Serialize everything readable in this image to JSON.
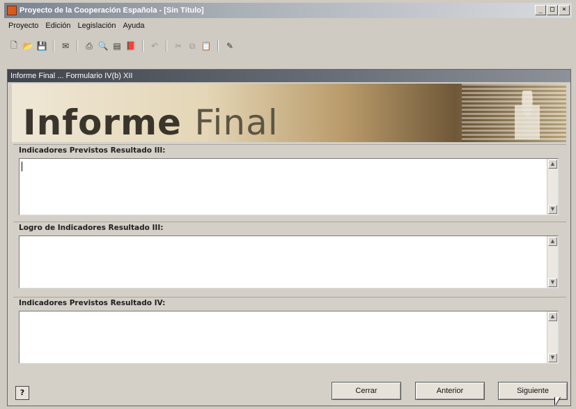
{
  "window": {
    "title": "Proyecto de la Cooperación Española - [Sin Título]",
    "buttons": [
      "_",
      "□",
      "×"
    ]
  },
  "menu": [
    "Proyecto",
    "Edición",
    "Legislación",
    "Ayuda"
  ],
  "toolbar": {
    "icons": [
      "new-file-icon",
      "open-folder-icon",
      "save-icon",
      "mail-icon",
      "print-icon",
      "print-preview-icon",
      "copy-window-icon",
      "book-icon",
      "undo-icon",
      "cut-icon",
      "copy-icon",
      "paste-icon",
      "edit-icon"
    ]
  },
  "form": {
    "title": "Informe Final ... Formulario IV(b)  XII",
    "banner_bold": "Informe",
    "banner_light": "Final",
    "sections": [
      {
        "label": "Indicadores Previstos Resultado III:",
        "value": ""
      },
      {
        "label": "Logro de Indicadores Resultado III:",
        "value": ""
      },
      {
        "label": "Indicadores Previstos Resultado IV:",
        "value": ""
      }
    ]
  },
  "footer": {
    "help": "?",
    "close": "Cerrar",
    "previous": "Anterior",
    "next": "Siguiente"
  }
}
